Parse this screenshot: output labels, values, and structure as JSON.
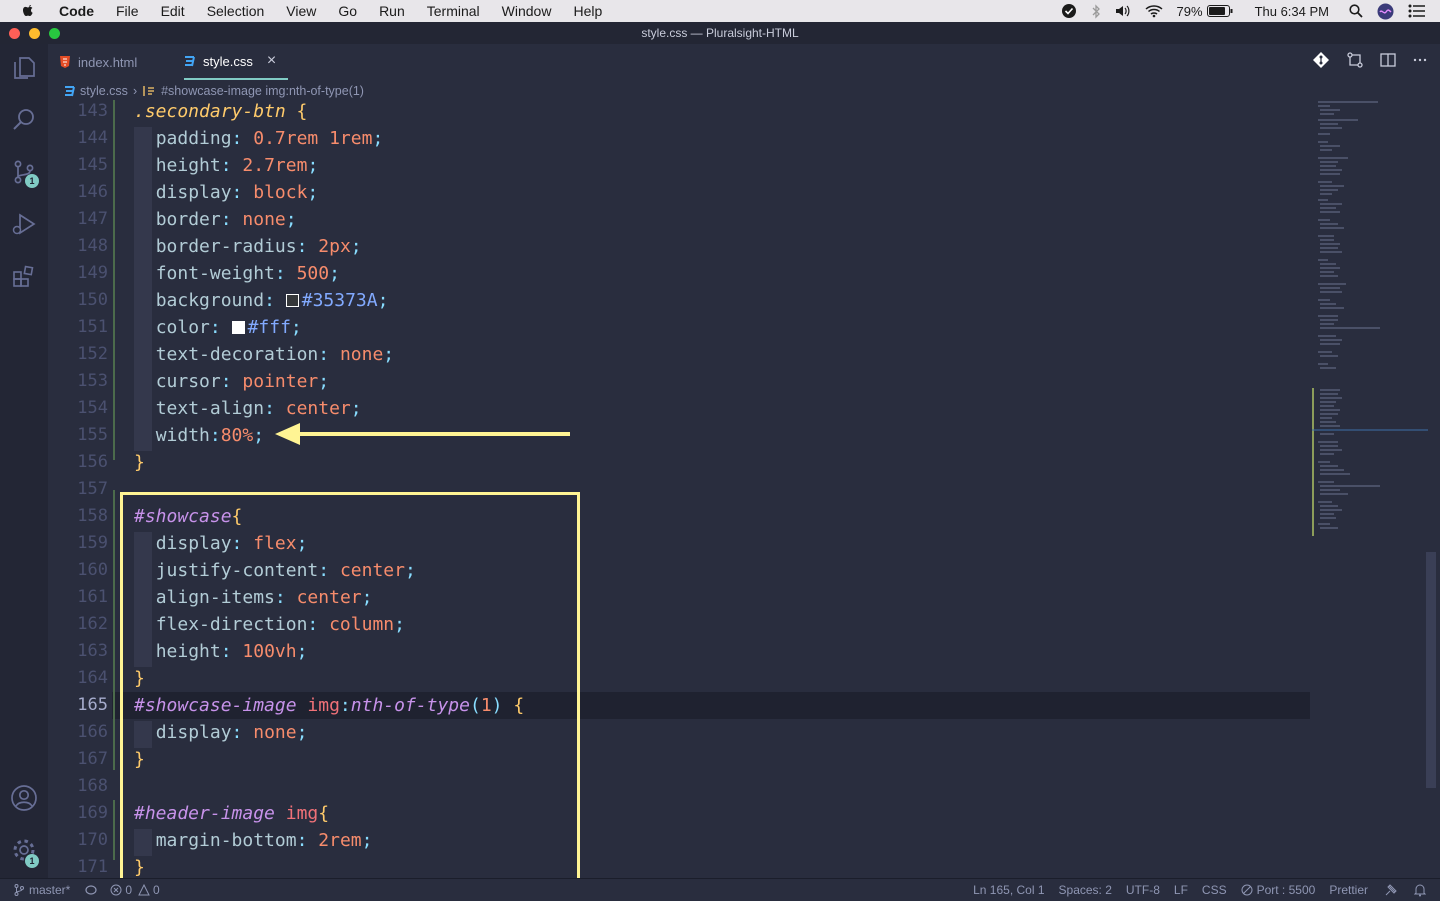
{
  "menubar": {
    "app": "Code",
    "items": [
      "File",
      "Edit",
      "Selection",
      "View",
      "Go",
      "Run",
      "Terminal",
      "Window",
      "Help"
    ],
    "battery": "79%",
    "clock": "Thu 6:34 PM"
  },
  "window": {
    "title": "style.css — Pluralsight-HTML"
  },
  "activity": {
    "scm_badge": "1",
    "settings_badge": "1"
  },
  "tabs": [
    {
      "label": "index.html",
      "icon": "html-file-icon"
    },
    {
      "label": "style.css",
      "icon": "css-file-icon",
      "close": "×"
    }
  ],
  "breadcrumb": {
    "file": "style.css",
    "sep": "›",
    "symbol": "#showcase-image img:nth-of-type(1)"
  },
  "editor": {
    "line_numbers": [
      "143",
      "144",
      "145",
      "146",
      "147",
      "148",
      "149",
      "150",
      "151",
      "152",
      "153",
      "154",
      "155",
      "156",
      "157",
      "158",
      "159",
      "160",
      "161",
      "162",
      "163",
      "164",
      "165",
      "166",
      "167",
      "168",
      "169",
      "170",
      "171"
    ],
    "lines": {
      "l143": {
        "sel": ".secondary-btn",
        "brace": " {"
      },
      "l144": {
        "prop": "padding",
        "val": "0.7rem 1rem"
      },
      "l145": {
        "prop": "height",
        "val": "2.7rem"
      },
      "l146": {
        "prop": "display",
        "val": "block"
      },
      "l147": {
        "prop": "border",
        "val": "none"
      },
      "l148": {
        "prop": "border-radius",
        "val": "2px"
      },
      "l149": {
        "prop": "font-weight",
        "val": "500"
      },
      "l150": {
        "prop": "background",
        "val": "#35373A"
      },
      "l151": {
        "prop": "color",
        "val": "#fff"
      },
      "l152": {
        "prop": "text-decoration",
        "val": "none"
      },
      "l153": {
        "prop": "cursor",
        "val": "pointer"
      },
      "l154": {
        "prop": "text-align",
        "val": "center"
      },
      "l155": {
        "prop": "width",
        "val": "80%"
      },
      "l156": {
        "brace": "}"
      },
      "l158": {
        "sel": "#showcase",
        "brace": "{"
      },
      "l159": {
        "prop": "display",
        "val": "flex"
      },
      "l160": {
        "prop": "justify-content",
        "val": "center"
      },
      "l161": {
        "prop": "align-items",
        "val": "center"
      },
      "l162": {
        "prop": "flex-direction",
        "val": "column"
      },
      "l163": {
        "prop": "height",
        "val": "100vh"
      },
      "l164": {
        "brace": "}"
      },
      "l165": {
        "sel": "#showcase-image",
        "tag": "img",
        "pseudo": "nth-of-type",
        "arg": "1",
        "brace": "{"
      },
      "l166": {
        "prop": "display",
        "val": "none"
      },
      "l167": {
        "brace": "}"
      },
      "l169": {
        "sel": "#header-image",
        "tag": "img",
        "brace": "{"
      },
      "l170": {
        "prop": "margin-bottom",
        "val": "2rem"
      },
      "l171": {
        "brace": "}"
      }
    }
  },
  "status": {
    "branch": "master*",
    "problems_errors": "0",
    "problems_warnings": "0",
    "cursor": "Ln 165, Col 1",
    "spaces": "Spaces: 2",
    "encoding": "UTF-8",
    "eol": "LF",
    "language": "CSS",
    "port": "Port : 5500",
    "formatter": "Prettier"
  },
  "colors": {
    "accent": "#80cbc4",
    "annotation": "#fff494",
    "background": "#292d3e"
  }
}
